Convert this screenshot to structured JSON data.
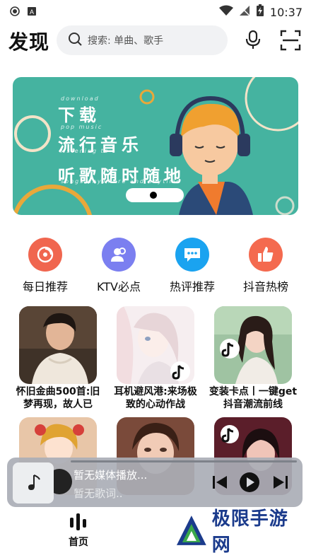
{
  "status_bar": {
    "time": "10:37"
  },
  "header": {
    "title": "发现",
    "search_placeholder": "搜索: 单曲、歌手"
  },
  "banner": {
    "line1": "下载",
    "line2": "流行音乐",
    "line3": "听歌随时随地",
    "small1": "download",
    "small2": "pop music",
    "small3": "listening to",
    "small4": "songs anywhere and anytime",
    "page_index": 1
  },
  "quick_entries": [
    {
      "label": "每日推荐",
      "icon": "disc-icon",
      "color": "#f0664f"
    },
    {
      "label": "KTV必点",
      "icon": "users-icon",
      "color": "#7b7ff0"
    },
    {
      "label": "热评推荐",
      "icon": "chat-bubble-icon",
      "color": "#1aa3f0"
    },
    {
      "label": "抖音热榜",
      "icon": "thumbs-up-icon",
      "color": "#f46a4f"
    }
  ],
  "playlists": [
    {
      "title": "怀旧金曲500首:旧梦再现，故人已"
    },
    {
      "title": "耳机避风港:来场极致的心动作战"
    },
    {
      "title": "变装卡点丨一键get抖音潮流前线"
    },
    {
      "title": ""
    },
    {
      "title": ""
    },
    {
      "title": ""
    }
  ],
  "mini_player": {
    "title": "暂无媒体播放...",
    "lyric": "暂无歌词.."
  },
  "bottom_nav": {
    "home_label": "首页",
    "watermark": "极限手游网"
  }
}
